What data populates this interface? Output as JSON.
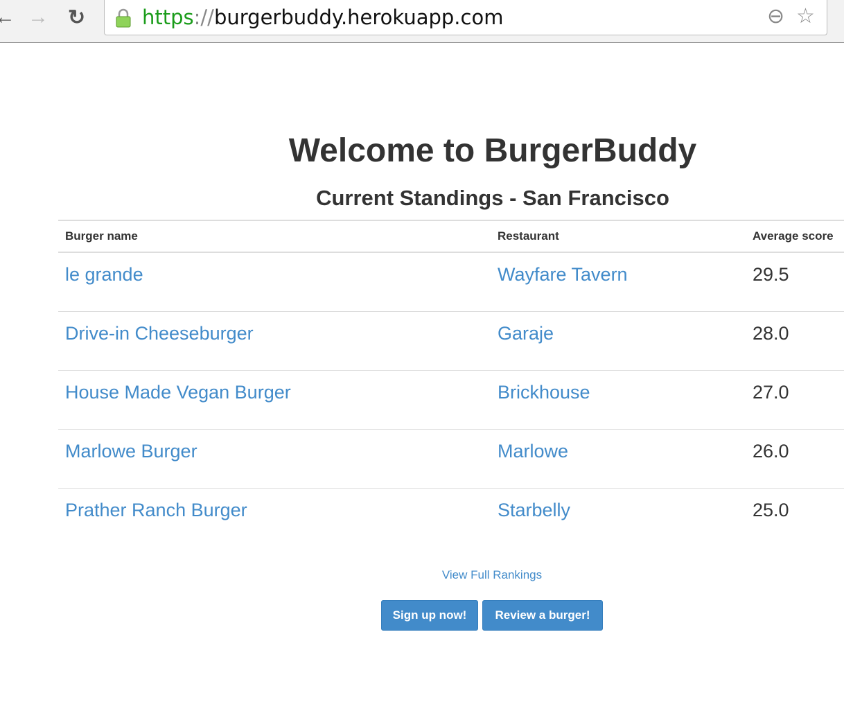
{
  "browser": {
    "url_scheme": "https",
    "url_sep": "://",
    "url_host": "burgerbuddy.herokuapp.com"
  },
  "page": {
    "title": "Welcome to BurgerBuddy",
    "subtitle": "Current Standings - San Francisco"
  },
  "table": {
    "headers": [
      "Burger name",
      "Restaurant",
      "Average score"
    ],
    "rows": [
      {
        "burger": "le grande",
        "restaurant": "Wayfare Tavern",
        "score": "29.5"
      },
      {
        "burger": "Drive-in Cheeseburger",
        "restaurant": "Garaje",
        "score": "28.0"
      },
      {
        "burger": "House Made Vegan Burger",
        "restaurant": "Brickhouse",
        "score": "27.0"
      },
      {
        "burger": "Marlowe Burger",
        "restaurant": "Marlowe",
        "score": "26.0"
      },
      {
        "burger": "Prather Ranch Burger",
        "restaurant": "Starbelly",
        "score": "25.0"
      }
    ]
  },
  "links": {
    "full_rankings": "View Full Rankings"
  },
  "buttons": {
    "signup": "Sign up now!",
    "review": "Review a burger!"
  },
  "colors": {
    "link": "#428bca",
    "button": "#428bca"
  }
}
